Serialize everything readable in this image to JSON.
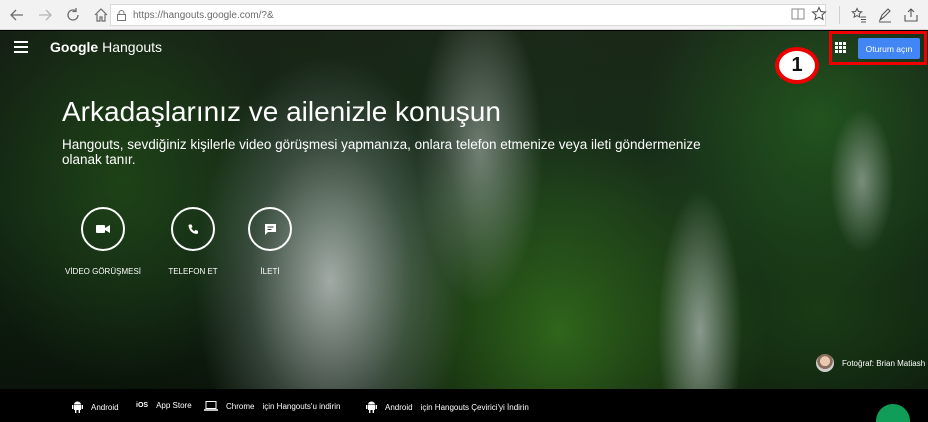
{
  "browser": {
    "url": "https://hangouts.google.com/?&",
    "icons": [
      "back-icon",
      "forward-icon",
      "refresh-icon",
      "home-icon",
      "lock-icon",
      "reader-view-icon",
      "favorite-star-icon",
      "favorites-bar-icon",
      "pen-icon",
      "share-icon"
    ]
  },
  "header": {
    "logo_part1": "Google",
    "logo_part2": " Hangouts",
    "signin_label": "Oturum açın",
    "callout_number": "1"
  },
  "hero": {
    "headline": "Arkadaşlarınız ve ailenizle konuşun",
    "subtext": "Hangouts, sevdiğiniz kişilerle video görüşmesi yapmanıza, onlara telefon etmenize veya ileti göndermenize olanak tanır.",
    "features": [
      {
        "label": "VİDEO GÖRÜŞMESİ",
        "icon": "videocam-icon"
      },
      {
        "label": "TELEFON ET",
        "icon": "phone-icon"
      },
      {
        "label": "İLETİ",
        "icon": "message-icon"
      }
    ],
    "credit": "Fotoğraf: Brian Matiash"
  },
  "footer": {
    "android": "Android",
    "ios_badge": "iOS",
    "app_store": "App Store",
    "chrome": "Chrome",
    "hangouts_download": "için Hangouts'u indirin",
    "android2": "Android",
    "dialer_download": "için Hangouts Çevirici'yi İndirin"
  },
  "colors": {
    "accent": "#4285f4",
    "annotation_red": "#e00000",
    "fab_green": "#0f9d58"
  }
}
